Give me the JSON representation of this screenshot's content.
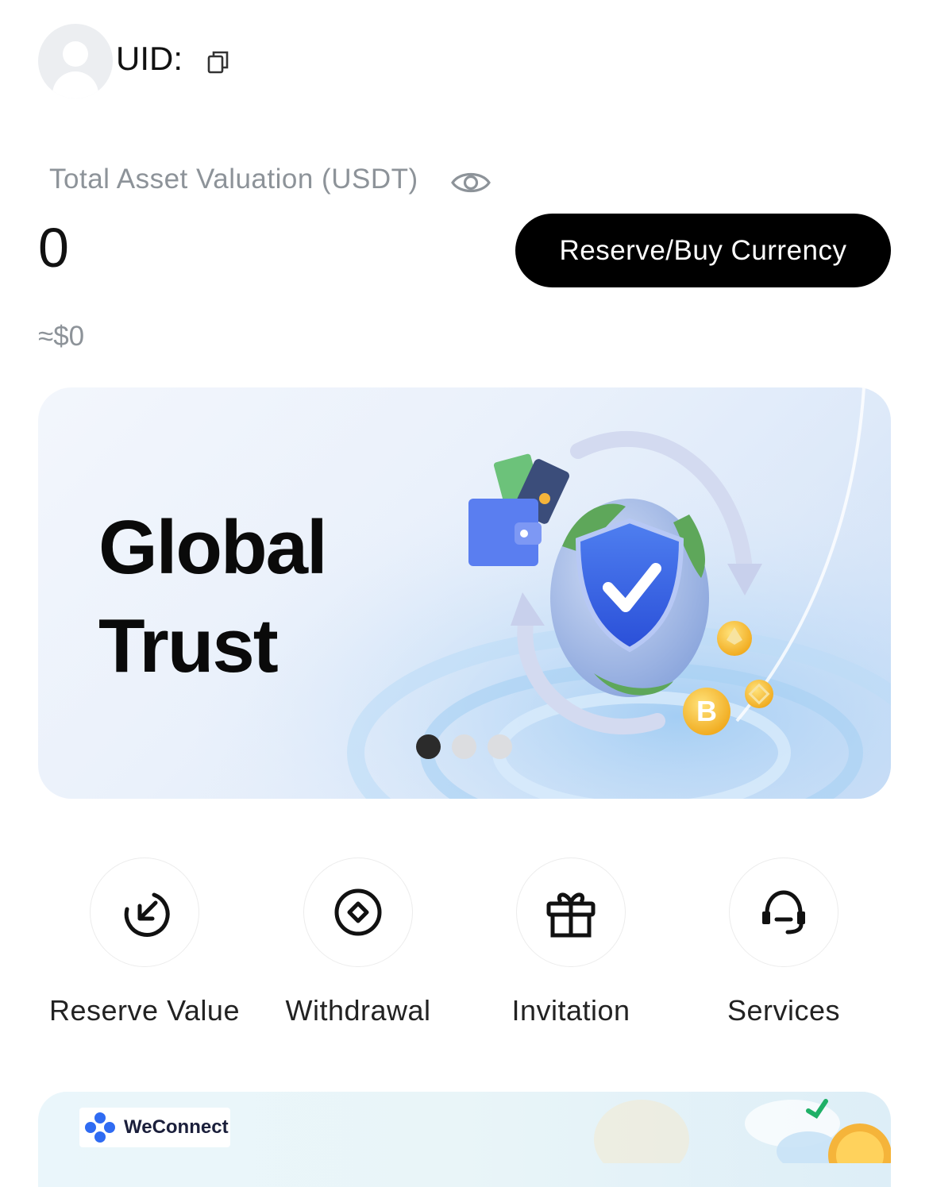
{
  "header": {
    "uid_label": "UID:"
  },
  "assets": {
    "label": "Total Asset Valuation (USDT)",
    "value": "0",
    "approx": "≈$0",
    "buy_button": "Reserve/Buy Currency"
  },
  "banner": {
    "title_line1": "Global",
    "title_line2": "Trust",
    "slide_count": 3,
    "active_slide": 1
  },
  "actions": [
    {
      "label": "Reserve Value",
      "icon": "reserve-arrow-icon"
    },
    {
      "label": "Withdrawal",
      "icon": "withdraw-diamond-icon"
    },
    {
      "label": "Invitation",
      "icon": "gift-icon"
    },
    {
      "label": "Services",
      "icon": "headset-icon"
    }
  ],
  "promo": {
    "brand": "WeConnect"
  },
  "colors": {
    "primary_button": "#000000",
    "muted_text": "#8d9399"
  }
}
